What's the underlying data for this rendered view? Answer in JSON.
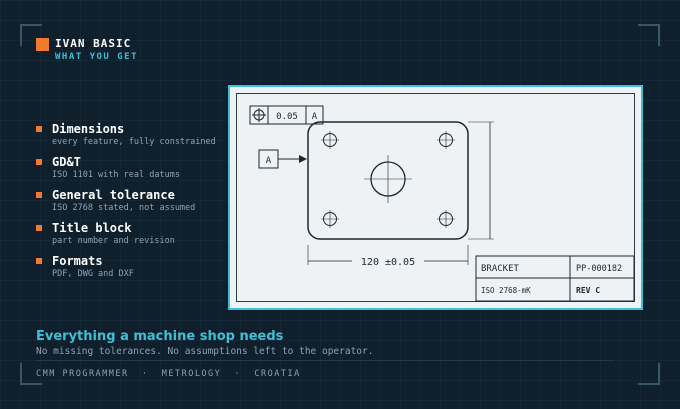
{
  "brand": {
    "name": "IVAN BASIC",
    "tagline": "WHAT YOU GET"
  },
  "features": [
    {
      "title": "Dimensions",
      "detail": "every feature, fully constrained"
    },
    {
      "title": "GD&T",
      "detail": "ISO 1101 with real datums"
    },
    {
      "title": "General tolerance",
      "detail": "ISO 2768 stated, not assumed"
    },
    {
      "title": "Title block",
      "detail": "part number and revision"
    },
    {
      "title": "Formats",
      "detail": "PDF, DWG and DXF"
    }
  ],
  "drawing": {
    "fcf_tolerance": "0.05",
    "fcf_datum": "A",
    "datum_label": "A",
    "width_dim": "120 ±0.05",
    "title_block": {
      "part_name": "BRACKET",
      "part_number": "PP-000182",
      "standard": "ISO 2768-mK",
      "revision": "REV C"
    }
  },
  "headline": "Everything a machine shop needs",
  "subline": "No missing tolerances. No assumptions left to the operator.",
  "footer": "CMM PROGRAMMER  ·  METROLOGY  ·  CROATIA",
  "colors": {
    "accent": "#3fbfd8",
    "brand": "#f07a2e",
    "background": "#0f1f2c"
  }
}
